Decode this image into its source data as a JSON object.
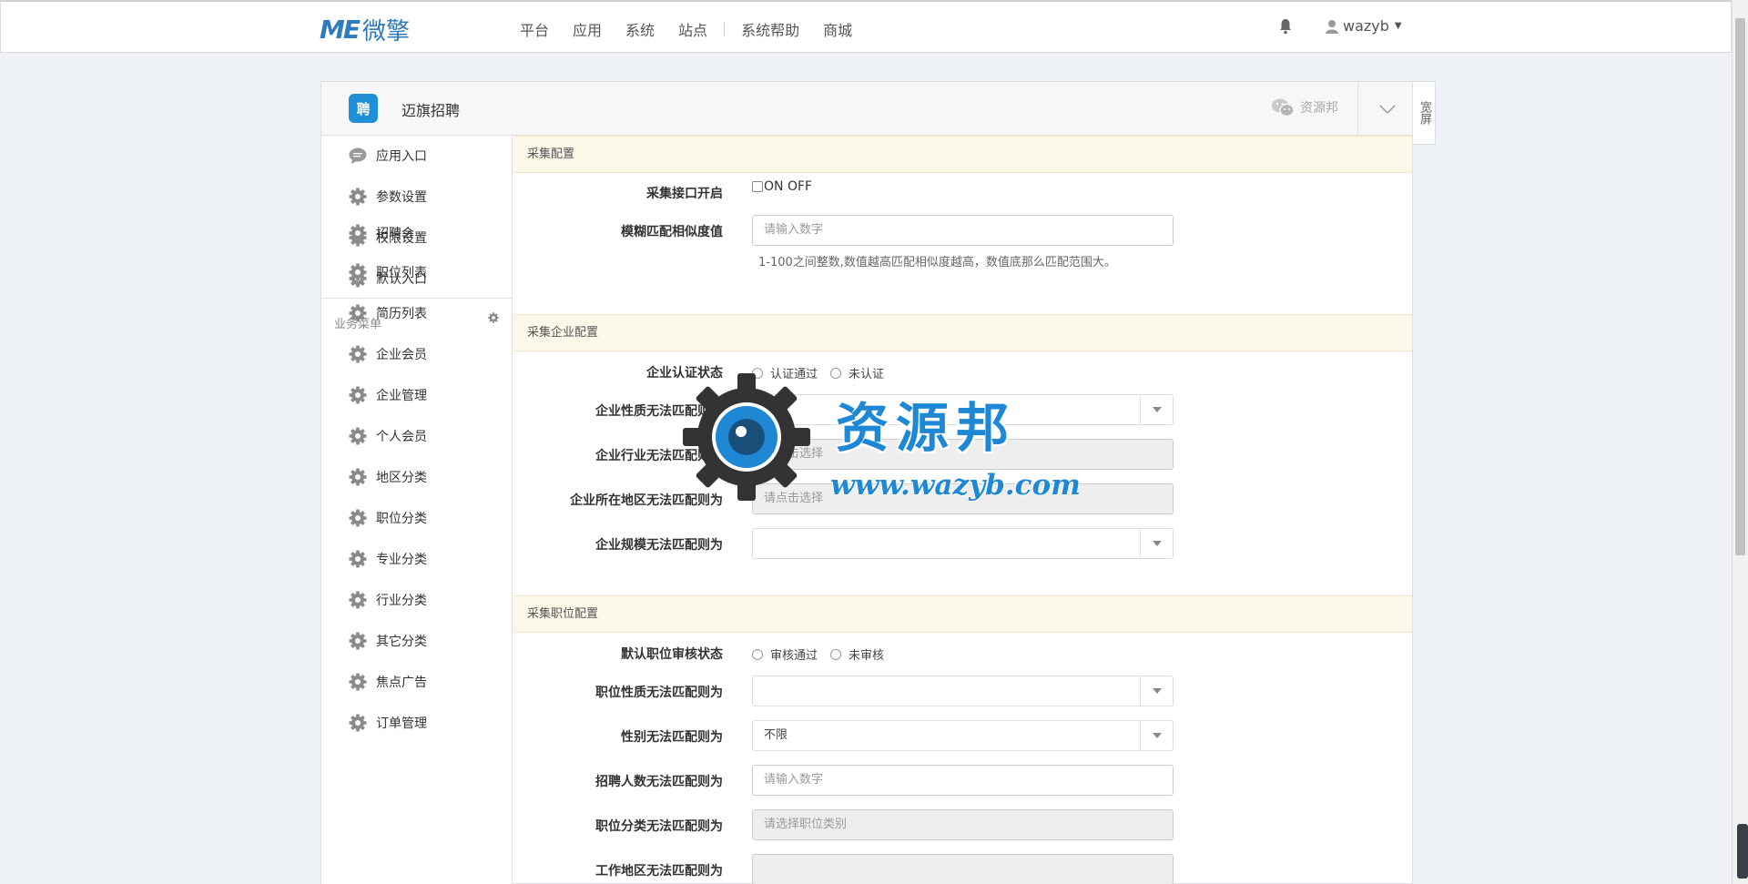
{
  "topbar": {
    "logo_mark": "ME",
    "logo_text": "微擎",
    "nav": [
      "平台",
      "应用",
      "系统",
      "站点",
      "系统帮助",
      "商城"
    ],
    "username": "wazyb"
  },
  "panel": {
    "app_icon_text": "聘",
    "app_name": "迈旗招聘",
    "wechat_label": "资源邦",
    "wide_label": "宽屏"
  },
  "sidebar": {
    "top_items": [
      "应用入口",
      "参数设置",
      "权限设置",
      "默认入口"
    ],
    "group_label": "业务菜单",
    "biz_items": [
      "招聘会",
      "职位列表",
      "简历列表",
      "企业会员",
      "企业管理",
      "个人会员",
      "地区分类",
      "职位分类",
      "专业分类",
      "行业分类",
      "其它分类",
      "焦点广告",
      "订单管理"
    ]
  },
  "section1": {
    "title": "采集配置",
    "switch_label": "采集接口开启",
    "switch_text": "ON OFF",
    "fuzzy_label": "模糊匹配相似度值",
    "fuzzy_placeholder": "请输入数字",
    "fuzzy_help": "1-100之间整数,数值越高匹配相似度越高，数值底那么匹配范围大。"
  },
  "section2": {
    "title": "采集企业配置",
    "auth_label": "企业认证状态",
    "auth_options": [
      "认证通过",
      "未认证"
    ],
    "nature_label": "企业性质无法匹配则为",
    "industry_label": "企业行业无法匹配则为",
    "industry_placeholder": "请点击选择",
    "region_label": "企业所在地区无法匹配则为",
    "region_placeholder": "请点击选择",
    "scale_label": "企业规模无法匹配则为"
  },
  "section3": {
    "title": "采集职位配置",
    "audit_label": "默认职位审核状态",
    "audit_options": [
      "审核通过",
      "未审核"
    ],
    "job_nature_label": "职位性质无法匹配则为",
    "gender_label": "性别无法匹配则为",
    "gender_value": "不限",
    "headcount_label": "招聘人数无法匹配则为",
    "headcount_placeholder": "请输入数字",
    "job_cat_label": "职位分类无法匹配则为",
    "job_cat_placeholder": "请选择职位类别",
    "work_region_label": "工作地区无法匹配则为"
  },
  "watermark": {
    "title": "资源邦",
    "url": "www.wazyb.com"
  }
}
